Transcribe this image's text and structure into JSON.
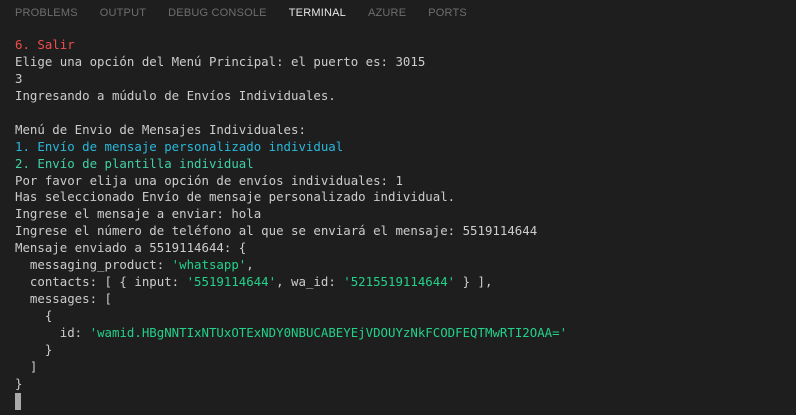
{
  "tabs": [
    {
      "label": "PROBLEMS",
      "active": false
    },
    {
      "label": "OUTPUT",
      "active": false
    },
    {
      "label": "DEBUG CONSOLE",
      "active": false
    },
    {
      "label": "TERMINAL",
      "active": true
    },
    {
      "label": "AZURE",
      "active": false
    },
    {
      "label": "PORTS",
      "active": false
    }
  ],
  "terminal": {
    "lines": [
      [
        {
          "text": "6. Salir",
          "color": "red"
        }
      ],
      [
        {
          "text": "Elige una opción del Menú Principal: el puerto es: 3015",
          "color": "def"
        }
      ],
      [
        {
          "text": "3",
          "color": "def"
        }
      ],
      [
        {
          "text": "Ingresando a múdulo de Envíos Individuales.",
          "color": "def"
        }
      ],
      [
        {
          "text": "",
          "color": "def"
        }
      ],
      [
        {
          "text": "Menú de Envio de Mensajes Individuales:",
          "color": "def"
        }
      ],
      [
        {
          "text": "1. Envío de mensaje personalizado individual",
          "color": "cyan"
        }
      ],
      [
        {
          "text": "2. Envío de plantilla individual",
          "color": "teal"
        }
      ],
      [
        {
          "text": "Por favor elija una opción de envíos individuales: 1",
          "color": "def"
        }
      ],
      [
        {
          "text": "Has seleccionado Envío de mensaje personalizado individual.",
          "color": "def"
        }
      ],
      [
        {
          "text": "Ingrese el mensaje a enviar: hola",
          "color": "def"
        }
      ],
      [
        {
          "text": "Ingrese el número de teléfono al que se enviará el mensaje: 5519114644",
          "color": "def"
        }
      ],
      [
        {
          "text": "Mensaje enviado a 5519114644: {",
          "color": "def"
        }
      ],
      [
        {
          "text": "  messaging_product: ",
          "color": "def"
        },
        {
          "text": "'whatsapp'",
          "color": "str"
        },
        {
          "text": ",",
          "color": "def"
        }
      ],
      [
        {
          "text": "  contacts: [ { input: ",
          "color": "def"
        },
        {
          "text": "'5519114644'",
          "color": "str"
        },
        {
          "text": ", wa_id: ",
          "color": "def"
        },
        {
          "text": "'5215519114644'",
          "color": "str"
        },
        {
          "text": " } ],",
          "color": "def"
        }
      ],
      [
        {
          "text": "  messages: [",
          "color": "def"
        }
      ],
      [
        {
          "text": "    {",
          "color": "def"
        }
      ],
      [
        {
          "text": "      id: ",
          "color": "def"
        },
        {
          "text": "'wamid.HBgNNTIxNTUxOTExNDY0NBUCABEYEjVDOUYzNkFCODFEQTMwRTI2OAA='",
          "color": "str"
        }
      ],
      [
        {
          "text": "    }",
          "color": "def"
        }
      ],
      [
        {
          "text": "  ]",
          "color": "def"
        }
      ],
      [
        {
          "text": "}",
          "color": "def"
        }
      ]
    ]
  },
  "colors": {
    "background": "#1e1e1e",
    "default_text": "#cccccc",
    "red": "#f14c4c",
    "cyan": "#29b8db",
    "teal": "#3fd1a4",
    "string_green": "#23d18b",
    "inactive_tab": "#6e6e6e",
    "active_tab": "#e7e7e7"
  }
}
